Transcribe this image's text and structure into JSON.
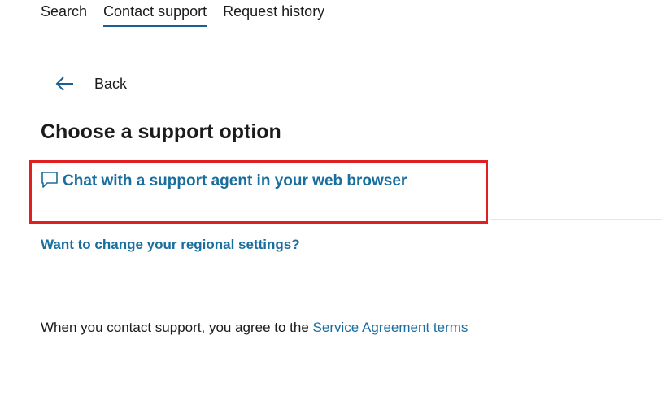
{
  "tabs": [
    {
      "label": "Search",
      "active": false
    },
    {
      "label": "Contact support",
      "active": true
    },
    {
      "label": "Request history",
      "active": false
    }
  ],
  "back": {
    "label": "Back",
    "icon": "arrow-left-icon"
  },
  "main": {
    "heading": "Choose a support option",
    "chat_option": {
      "label": "Chat with a support agent in your web browser",
      "icon": "chat-bubble-icon"
    },
    "regional_link": "Want to change your regional settings?",
    "agreement": {
      "prefix": "When you contact support, you agree to the ",
      "link": "Service Agreement terms"
    }
  },
  "colors": {
    "link": "#1a6e9e",
    "highlight_box": "#e02020",
    "tab_underline": "#1f5f8f"
  }
}
